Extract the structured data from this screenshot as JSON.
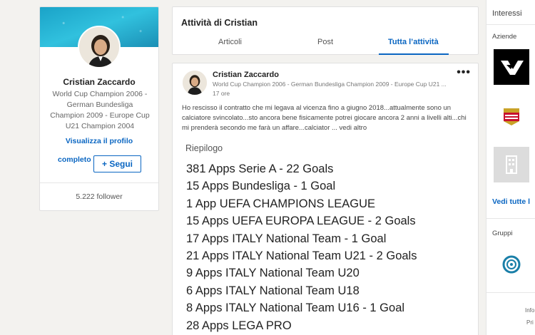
{
  "profile": {
    "name": "Cristian Zaccardo",
    "headline": "World Cup Champion 2006 - German Bundesliga Champion 2009 - Europe Cup U21 Champion 2004",
    "view_profile_line1": "Visualizza il profilo",
    "view_profile_line2": "completo",
    "follow_label": "Segui",
    "follow_icon": "plus-icon",
    "followers": "5.222 follower"
  },
  "activity": {
    "title": "Attività di Cristian",
    "tabs": [
      {
        "label": "Articoli",
        "active": false
      },
      {
        "label": "Post",
        "active": false
      },
      {
        "label": "Tutta l’attività",
        "active": true
      }
    ]
  },
  "post": {
    "author": "Cristian Zaccardo",
    "author_headline": "World Cup Champion 2006 - German Bundesliga Champion 2009 - Europe Cup U21 ...",
    "time": "17 ore",
    "more_icon": "more-icon",
    "text": "Ho rescisso il contratto che mi legava al vicenza fino a giugno 2018...attualmente sono un calciatore svincolato...sto ancora bene fisicamente potrei giocare ancora 2 anni a livelli alti...chi mi prenderà secondo me farà un affare...calciator",
    "see_more": "... vedi altro",
    "summary_title": "Riepilogo",
    "summary_items": [
      "381 Apps Serie A -  22 Goals",
      "15 Apps Bundesliga - 1 Goal",
      "1 App UEFA CHAMPIONS LEAGUE",
      "15 Apps UEFA EUROPA LEAGUE - 2 Goals",
      "17 Apps ITALY National Team - 1 Goal",
      "21 Apps ITALY National Team U21 - 2 Goals",
      "9 Apps ITALY National Team U20",
      "6 Apps ITALY National Team U18",
      "8 Apps ITALY National Team U16 - 1 Goal",
      "28 Apps LEGA PRO"
    ]
  },
  "right": {
    "interests": "Interessi",
    "companies_label": "Aziende",
    "see_all": "Vedi tutte l",
    "groups_label": "Gruppi",
    "footer_1": "Info",
    "footer_2": "Pri",
    "colors": {
      "accent": "#0a66c2"
    }
  }
}
